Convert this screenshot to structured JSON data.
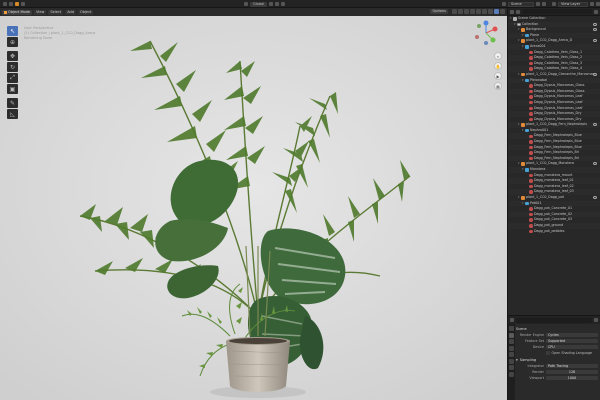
{
  "topbar": {
    "view_chips": [
      "Global"
    ],
    "scene_name": "Scene",
    "view_layer": "View Layer"
  },
  "viewport": {
    "mode": "Object Mode",
    "menus": [
      "View",
      "Select",
      "Add",
      "Object"
    ],
    "overlay_options": "Options",
    "overlay_lines": [
      "User Perspective",
      "(1) Collection | plant_1_CC0_Dagg_Areca",
      "Rendering Done"
    ]
  },
  "outliner": {
    "rows": [
      {
        "label": "Scene Collection",
        "icon": "scene",
        "indent": 0,
        "eye": false
      },
      {
        "label": "Collection",
        "icon": "coll",
        "indent": 1,
        "eye": true
      },
      {
        "label": "Background",
        "icon": "obj",
        "indent": 2,
        "eye": true
      },
      {
        "label": "Plane",
        "icon": "mesh",
        "indent": 3,
        "eye": false
      },
      {
        "label": "plant_1_CC0_Dagg_Areca_D",
        "icon": "obj",
        "indent": 2,
        "eye": true
      },
      {
        "label": "Areca001",
        "icon": "mesh",
        "indent": 3,
        "eye": false
      },
      {
        "label": "Dagg_Calathea_Vein_Glass_1",
        "icon": "mat",
        "indent": 4,
        "eye": false
      },
      {
        "label": "Dagg_Calathea_Vein_Glass_2",
        "icon": "mat",
        "indent": 4,
        "eye": false
      },
      {
        "label": "Dagg_Calathea_Vein_Glass_3",
        "icon": "mat",
        "indent": 4,
        "eye": false
      },
      {
        "label": "Dagg_Calathea_Vein_Glass_4",
        "icon": "mat",
        "indent": 4,
        "eye": false
      },
      {
        "label": "plant_1_CC0_Dagg_Ctenanthe_Marcomas",
        "icon": "obj",
        "indent": 2,
        "eye": true
      },
      {
        "label": "Pleionabal",
        "icon": "mesh",
        "indent": 3,
        "eye": false
      },
      {
        "label": "Dagg_Dypsis_Marcomas_Glass",
        "icon": "mat",
        "indent": 4,
        "eye": false
      },
      {
        "label": "Dagg_Dypsis_Marcomas_Glass",
        "icon": "mat",
        "indent": 4,
        "eye": false
      },
      {
        "label": "Dagg_Dypsis_Marcomas_Leaf",
        "icon": "mat",
        "indent": 4,
        "eye": false
      },
      {
        "label": "Dagg_Dypsis_Marcomas_Leaf",
        "icon": "mat",
        "indent": 4,
        "eye": false
      },
      {
        "label": "Dagg_Dypsis_Marcomas_Leaf",
        "icon": "mat",
        "indent": 4,
        "eye": false
      },
      {
        "label": "Dagg_Dypsis_Marcomas_Dry",
        "icon": "mat",
        "indent": 4,
        "eye": false
      },
      {
        "label": "Dagg_Dypsis_Marcomas_Dry",
        "icon": "mat",
        "indent": 4,
        "eye": false
      },
      {
        "label": "plant_1_CC0_Dagg_Fern_Nephrolepis",
        "icon": "obj",
        "indent": 2,
        "eye": true
      },
      {
        "label": "Nephro001",
        "icon": "mesh",
        "indent": 3,
        "eye": false
      },
      {
        "label": "Dagg_Fern_Nephrolepis_Blue",
        "icon": "mat",
        "indent": 4,
        "eye": false
      },
      {
        "label": "Dagg_Fern_Nephrolepis_Blue",
        "icon": "mat",
        "indent": 4,
        "eye": false
      },
      {
        "label": "Dagg_Fern_Nephrolepis_Blue",
        "icon": "mat",
        "indent": 4,
        "eye": false
      },
      {
        "label": "Dagg_Fern_Nephrolepis_Bri",
        "icon": "mat",
        "indent": 4,
        "eye": false
      },
      {
        "label": "Dagg_Fern_Nephrolepis_Bri",
        "icon": "mat",
        "indent": 4,
        "eye": false
      },
      {
        "label": "plant_1_CC0_Dagg_Monstera",
        "icon": "obj",
        "indent": 2,
        "eye": true
      },
      {
        "label": "Monstera",
        "icon": "mesh",
        "indent": 3,
        "eye": false
      },
      {
        "label": "Dagg_monstera_mount",
        "icon": "mat",
        "indent": 4,
        "eye": false
      },
      {
        "label": "Dagg_monstera_leaf_01",
        "icon": "mat",
        "indent": 4,
        "eye": false
      },
      {
        "label": "Dagg_monstera_leaf_02",
        "icon": "mat",
        "indent": 4,
        "eye": false
      },
      {
        "label": "Dagg_monstera_leaf_03",
        "icon": "mat",
        "indent": 4,
        "eye": false
      },
      {
        "label": "plant_1_CC0_Dagg_pot",
        "icon": "obj",
        "indent": 2,
        "eye": true
      },
      {
        "label": "Pot001",
        "icon": "mesh",
        "indent": 3,
        "eye": false
      },
      {
        "label": "Dagg_pot_Concrete_01",
        "icon": "mat",
        "indent": 4,
        "eye": false
      },
      {
        "label": "Dagg_pot_Concrete_02",
        "icon": "mat",
        "indent": 4,
        "eye": false
      },
      {
        "label": "Dagg_pot_Concrete_03",
        "icon": "mat",
        "indent": 4,
        "eye": false
      },
      {
        "label": "Dagg_pot_ground",
        "icon": "mat",
        "indent": 4,
        "eye": false
      },
      {
        "label": "Dagg_pot_pebbles",
        "icon": "mat",
        "indent": 4,
        "eye": false
      }
    ]
  },
  "properties": {
    "panel_title": "Scene",
    "render_engine_label": "Render Engine",
    "render_engine_value": "Cycles",
    "feature_set_label": "Feature Set",
    "feature_set_value": "Supported",
    "device_label": "Device",
    "device_value": "CPU",
    "osl_label": "Open Shading Language",
    "sampling_label": "Sampling",
    "integrator_label": "Integrator",
    "integrator_value": "Path Tracing",
    "render_label": "Render",
    "render_value": "128",
    "viewport_label": "Viewport",
    "viewport_value": "1000"
  }
}
